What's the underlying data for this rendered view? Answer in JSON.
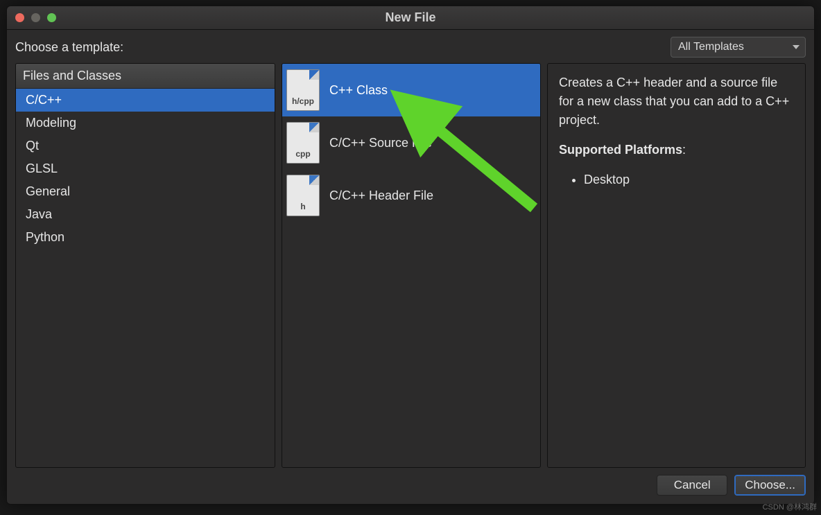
{
  "window": {
    "title": "New File"
  },
  "topbar": {
    "label": "Choose a template:",
    "filter": "All Templates"
  },
  "categories": {
    "header": "Files and Classes",
    "items": [
      {
        "label": "C/C++",
        "selected": true
      },
      {
        "label": "Modeling",
        "selected": false
      },
      {
        "label": "Qt",
        "selected": false
      },
      {
        "label": "GLSL",
        "selected": false
      },
      {
        "label": "General",
        "selected": false
      },
      {
        "label": "Java",
        "selected": false
      },
      {
        "label": "Python",
        "selected": false
      }
    ]
  },
  "templates": {
    "items": [
      {
        "label": "C++ Class",
        "icon_ext": "h/cpp",
        "selected": true
      },
      {
        "label": "C/C++ Source File",
        "icon_ext": "cpp",
        "selected": false
      },
      {
        "label": "C/C++ Header File",
        "icon_ext": "h",
        "selected": false
      }
    ]
  },
  "description": {
    "text": "Creates a C++ header and a source file for a new class that you can add to a C++ project.",
    "platforms_heading": "Supported Platforms",
    "platforms": [
      "Desktop"
    ]
  },
  "buttons": {
    "cancel": "Cancel",
    "choose": "Choose..."
  },
  "watermark": "CSDN @林鸿群"
}
